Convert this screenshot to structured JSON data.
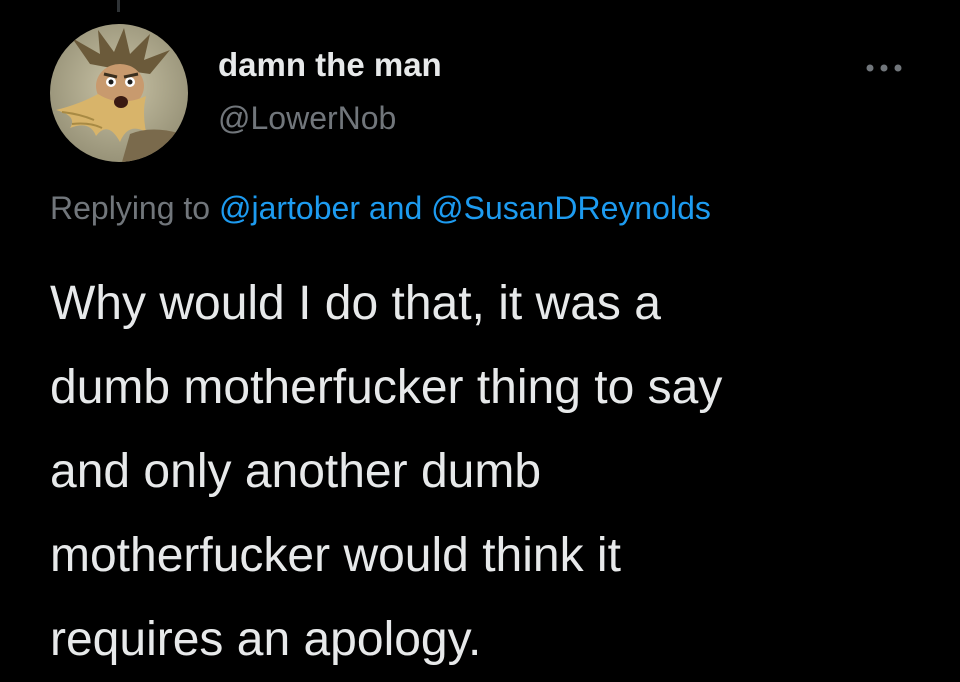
{
  "tweet": {
    "author": {
      "display_name": "damn the man",
      "handle": "@LowerNob",
      "avatar": "bearded-man-illustration"
    },
    "more_icon": "ellipsis-horizontal-icon",
    "replying": {
      "prefix": "Replying to",
      "mention_1": "@jartober",
      "joiner": "and",
      "mention_2": "@SusanDReynolds"
    },
    "text": "Why would I do that, it was a\ndumb motherfucker thing to say\nand only another dumb\nmotherfucker would think it\nrequires an apology."
  },
  "colors": {
    "background": "#000000",
    "primary_text": "#e7e9ea",
    "secondary_text": "#71767b",
    "link": "#1d9bf0"
  }
}
